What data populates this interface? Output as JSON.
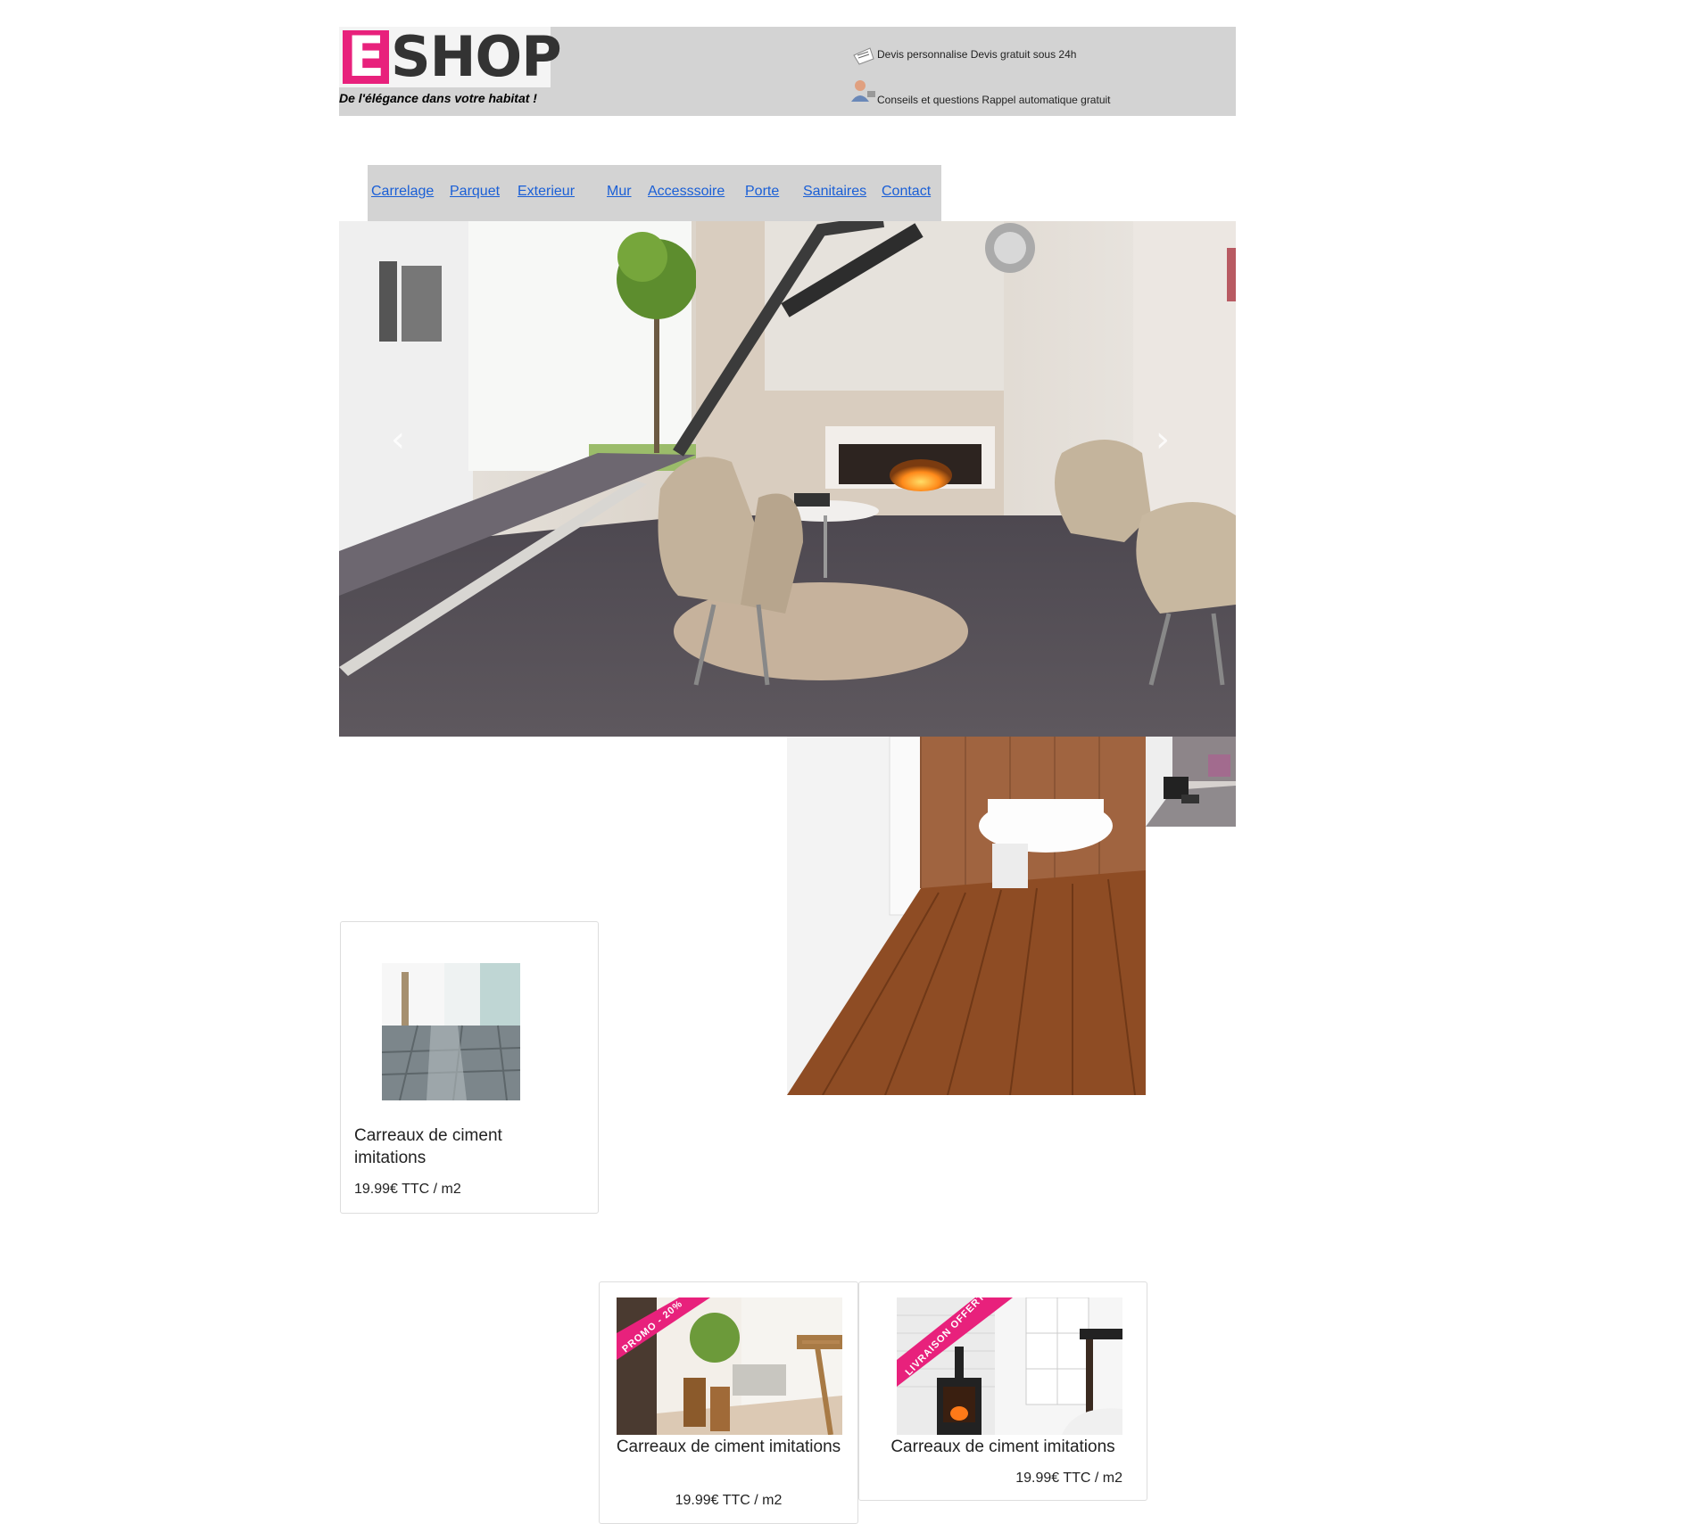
{
  "brand": {
    "logo_letter": "E",
    "logo_rest": "SHOP",
    "tagline": "De l'élégance dans votre habitat !",
    "accent_color": "#e8217c"
  },
  "header_info": [
    {
      "icon": "quote-icon",
      "text": "Devis personnalise Devis gratuit sous 24h"
    },
    {
      "icon": "advisor-icon",
      "text": "Conseils et questions Rappel automatique gratuit"
    }
  ],
  "nav": {
    "items": [
      "Carrelage",
      "Parquet",
      "Exterieur",
      "Mur",
      "Accesssoire",
      "Porte",
      "Sanitaires",
      "Contact"
    ],
    "link_color": "#1a5fd6"
  },
  "carousel": {
    "prev_icon": "‹",
    "next_icon": "›"
  },
  "products": [
    {
      "title": "Carreaux de ciment imitations",
      "price": "19.99€ TTC / m2"
    },
    {
      "title": "Carreaux de ciment imitations",
      "price": "19.99€ TTC / m2",
      "badge": "PROMO - 20%"
    },
    {
      "title": "Carreaux de ciment imitations",
      "price": "19.99€ TTC / m2",
      "badge": "LIVRAISON OFFERTE"
    }
  ]
}
